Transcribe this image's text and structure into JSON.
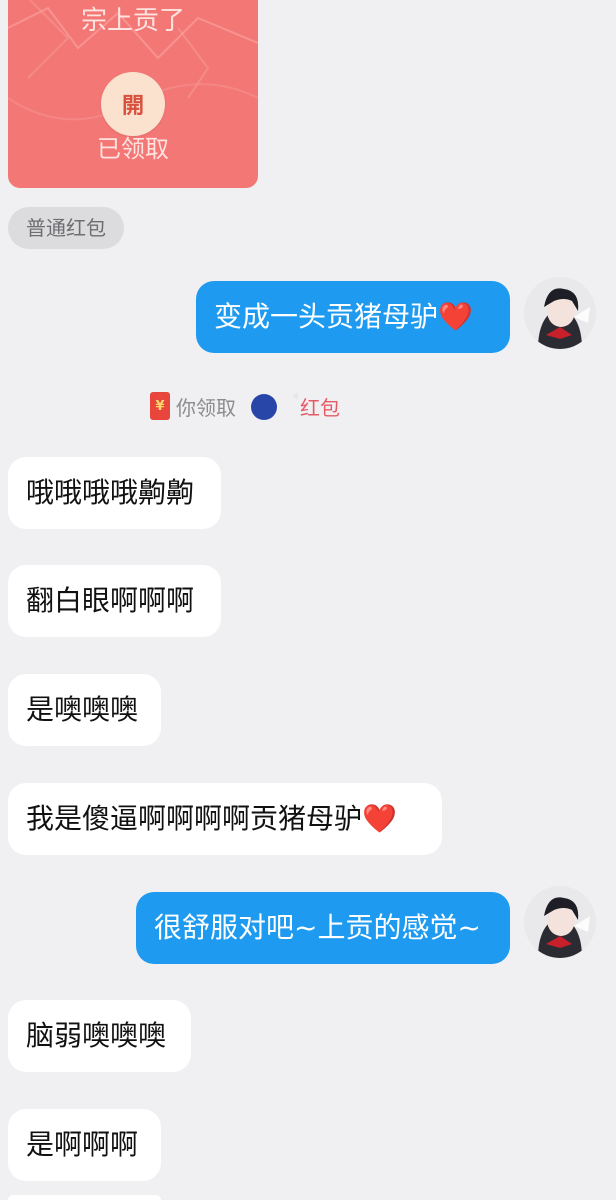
{
  "red_packet": {
    "subtitle": "宗上贡了",
    "open_glyph": "開",
    "status": "已领取",
    "type_label": "普通红包"
  },
  "notice": {
    "packet_symbol": "¥",
    "text": "你领取",
    "link": "红包"
  },
  "messages": [
    {
      "side": "outgoing",
      "text": "变成一头贡猪母驴❤️"
    },
    {
      "side": "incoming",
      "text": "哦哦哦哦齁齁"
    },
    {
      "side": "incoming",
      "text": "翻白眼啊啊啊"
    },
    {
      "side": "incoming",
      "text": "是噢噢噢"
    },
    {
      "side": "incoming",
      "text": "我是傻逼啊啊啊啊贡猪母驴❤️"
    },
    {
      "side": "outgoing",
      "text": "很舒服对吧~上贡的感觉~"
    },
    {
      "side": "incoming",
      "text": "脑弱噢噢噢"
    },
    {
      "side": "incoming",
      "text": "是啊啊啊"
    }
  ],
  "colors": {
    "background": "#f0f0f2",
    "outgoing_bubble": "#1e9bf0",
    "incoming_bubble": "#ffffff",
    "red_packet": "#f37775"
  }
}
